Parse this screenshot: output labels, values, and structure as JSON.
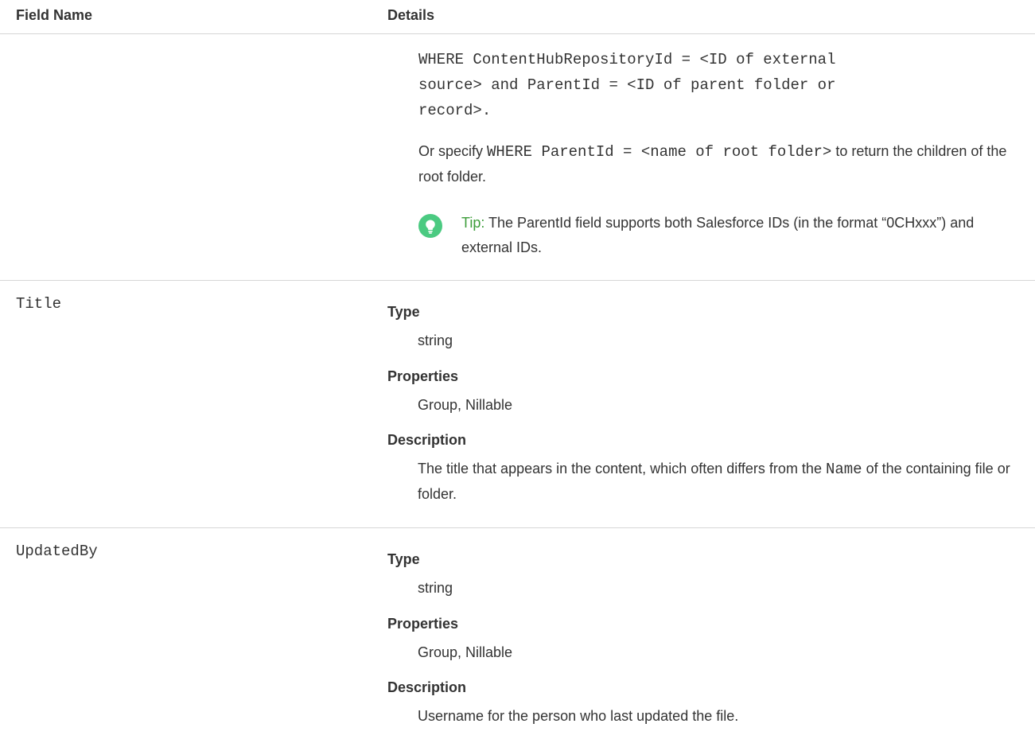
{
  "header": {
    "field_name": "Field Name",
    "details": "Details"
  },
  "rows": {
    "content_hub": {
      "code_line1": "WHERE ContentHubRepositoryId = <ID of external",
      "code_line2": "source> and ParentId = <ID of parent folder or",
      "code_line3": "record>.",
      "or_prefix": "Or specify ",
      "or_code": "WHERE ParentId = <name of root folder>",
      "or_suffix": " to return the children of the root folder.",
      "tip_label": "Tip:",
      "tip_text": " The ParentId field supports both Salesforce IDs (in the format “0CHxxx”) and external IDs."
    },
    "title": {
      "field": "Title",
      "type_label": "Type",
      "type_value": "string",
      "properties_label": "Properties",
      "properties_value": "Group, Nillable",
      "description_label": "Description",
      "description_prefix": "The title that appears in the content, which often differs from the ",
      "description_code": "Name",
      "description_suffix": " of the containing file or folder."
    },
    "updated_by": {
      "field": "UpdatedBy",
      "type_label": "Type",
      "type_value": "string",
      "properties_label": "Properties",
      "properties_value": "Group, Nillable",
      "description_label": "Description",
      "description_value": "Username for the person who last updated the file."
    }
  },
  "icons": {
    "tip": "lightbulb-icon"
  },
  "colors": {
    "tip_icon_bg": "#4bca81",
    "tip_label": "#3d9d3a",
    "divider": "#d6d6d6",
    "text": "#333333"
  }
}
